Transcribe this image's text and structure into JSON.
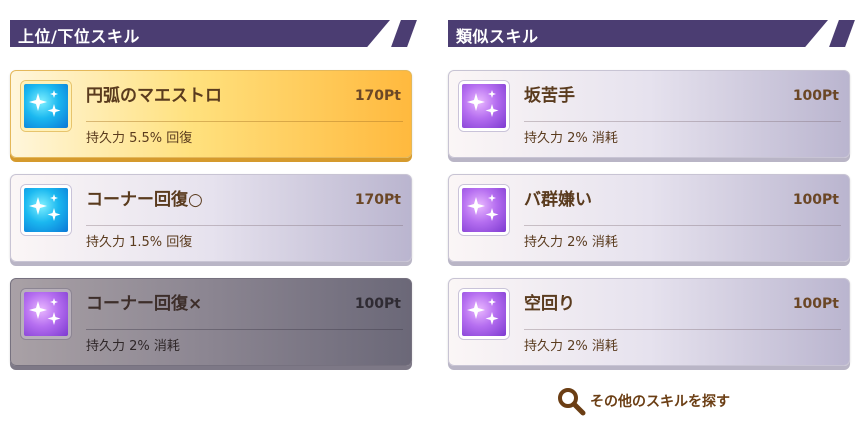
{
  "left_section": {
    "title": "上位/下位スキル",
    "cards": [
      {
        "name": "円弧のマエストロ",
        "points": "170Pt",
        "effect": "持久力 5.5% 回復",
        "icon": "blue-sparkle-icon",
        "style": "gold"
      },
      {
        "name": "コーナー回復○",
        "points": "170Pt",
        "effect": "持久力 1.5% 回復",
        "icon": "blue-sparkle-icon",
        "style": "normal"
      },
      {
        "name": "コーナー回復×",
        "points": "100Pt",
        "effect": "持久力 2% 消耗",
        "icon": "purple-sparkle-icon",
        "style": "dark"
      }
    ]
  },
  "right_section": {
    "title": "類似スキル",
    "cards": [
      {
        "name": "坂苦手",
        "points": "100Pt",
        "effect": "持久力 2% 消耗",
        "icon": "purple-sparkle-icon",
        "style": "normal"
      },
      {
        "name": "バ群嫌い",
        "points": "100Pt",
        "effect": "持久力 2% 消耗",
        "icon": "purple-sparkle-icon",
        "style": "normal"
      },
      {
        "name": "空回り",
        "points": "100Pt",
        "effect": "持久力 2% 消耗",
        "icon": "purple-sparkle-icon",
        "style": "normal"
      }
    ]
  },
  "search_link": {
    "label": "その他のスキルを探す",
    "icon": "search-icon"
  },
  "colors": {
    "header_bg": "#4b3d72",
    "text_brown": "#5a3b1e",
    "gold_card": "#ffb93e",
    "icon_blue": "#1bb8f0",
    "icon_purple": "#b56ef0"
  }
}
